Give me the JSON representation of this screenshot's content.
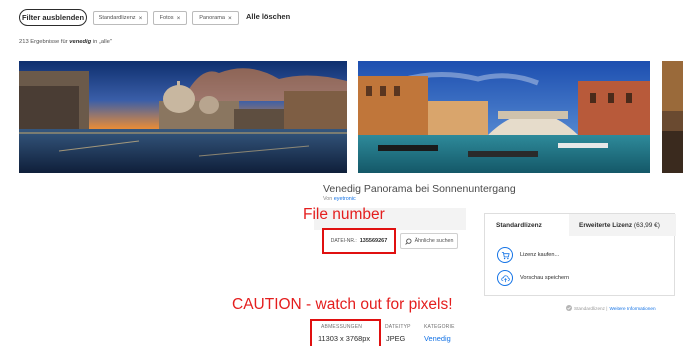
{
  "filters": {
    "toggle_label": "Filter ausblenden",
    "chips": [
      {
        "label": "Standardlizenz",
        "remove": "×"
      },
      {
        "label": "Fotos",
        "remove": "×"
      },
      {
        "label": "Panorama",
        "remove": "×"
      }
    ],
    "clear_all": "Alle löschen"
  },
  "results": {
    "prefix": "213 Ergebnisse für ",
    "query": "venedig",
    "suffix": " in „alle\""
  },
  "detail": {
    "title": "Venedig Panorama bei Sonnenuntergang",
    "author_prefix": "Von ",
    "author": "eyetronic",
    "file_label": "DATEI-NR.:",
    "file_number": "135569267",
    "similar_button": "Ähnliche suchen"
  },
  "license": {
    "tab_standard": "Standardlizenz",
    "tab_extended": "Erweiterte Lizenz",
    "tab_extended_price": "(63,99 €)",
    "buy_label": "Lizenz kaufen...",
    "save_preview_label": "Vorschau speichern",
    "footer_text": "Standardlizenz |",
    "footer_link": "Weitere Informationen"
  },
  "metadata": {
    "dimensions_label": "ABMESSUNGEN",
    "dimensions_value": "11303 x 3768px",
    "filetype_label": "DATEITYP",
    "filetype_value": "JPEG",
    "category_label": "KATEGORIE",
    "category_value": "Venedig"
  },
  "annotations": {
    "file_number_note": "File number",
    "caution_note": "CAUTION - watch out for pixels!"
  },
  "colors": {
    "accent": "#1473e6",
    "annotation_red": "#e41e1e"
  },
  "icons": [
    "close-icon",
    "search-icon",
    "cart-icon",
    "cloud-upload-icon",
    "check-circle-icon"
  ]
}
